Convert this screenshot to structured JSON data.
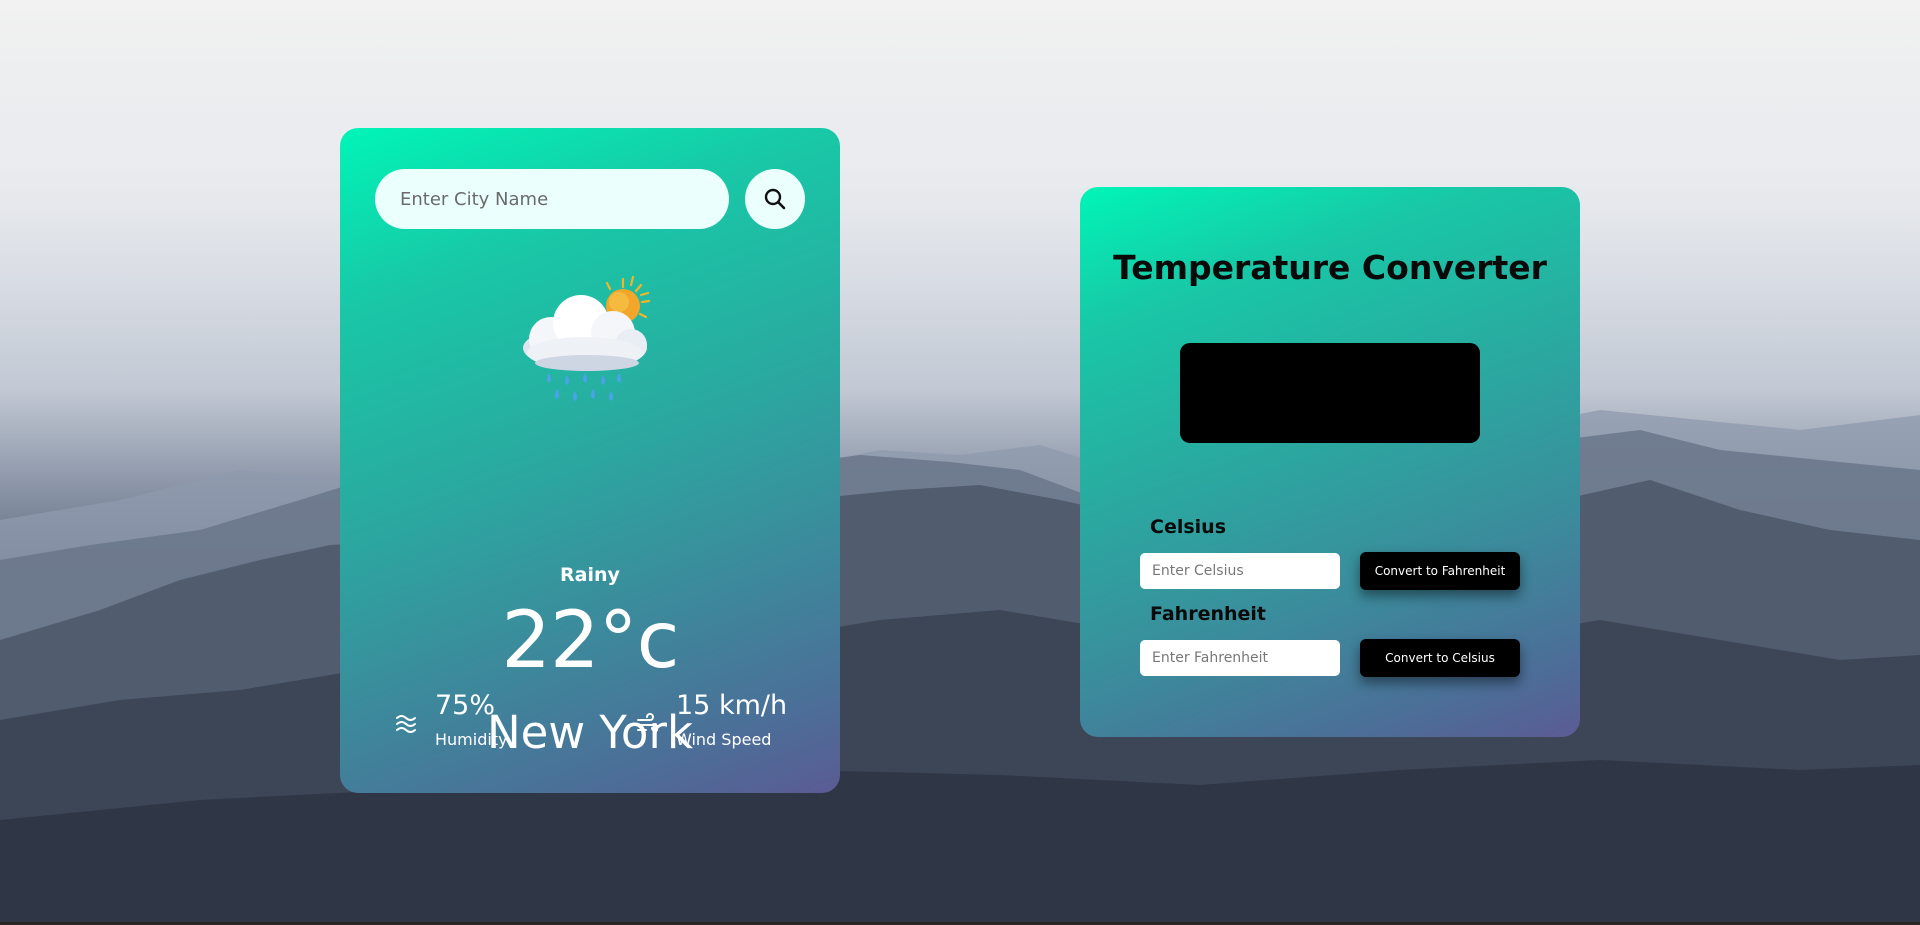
{
  "weather": {
    "search": {
      "placeholder": "Enter City Name"
    },
    "condition": "Rainy",
    "temperature": "22°c",
    "city": "New York",
    "humidity": {
      "value": "75%",
      "label": "Humidity",
      "icon": "humidity-waves-icon"
    },
    "wind": {
      "value": "15 km/h",
      "label": "Wind Speed",
      "icon": "wind-icon"
    },
    "weather_icon": "rain-cloud-sun-icon",
    "search_icon": "search-icon"
  },
  "converter": {
    "title": "Temperature Converter",
    "celsius": {
      "label": "Celsius",
      "placeholder": "Enter Celsius",
      "button": "Convert to Fahrenheit"
    },
    "fahrenheit": {
      "label": "Fahrenheit",
      "placeholder": "Enter Fahrenheit",
      "button": "Convert to Celsius"
    }
  },
  "colors": {
    "card_gradient_start": "#00f5b8",
    "card_gradient_end": "#5b5b93",
    "input_bg": "#ebfffc",
    "button_bg": "#000000"
  }
}
